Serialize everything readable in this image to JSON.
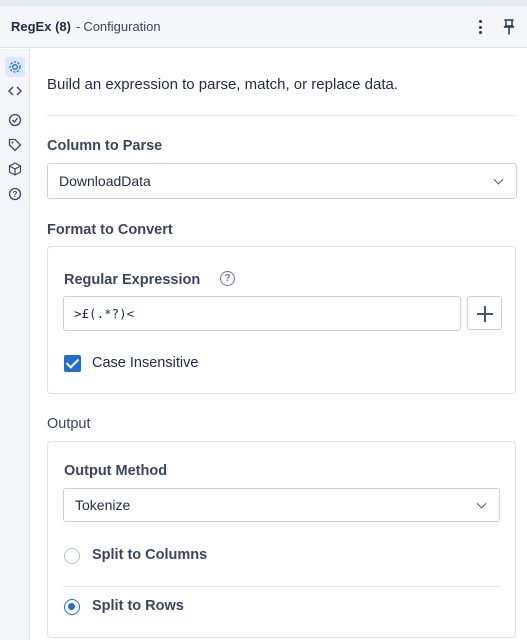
{
  "header": {
    "title_main": "RegEx (8)",
    "title_sep": "-",
    "title_sub": "Configuration"
  },
  "rail": {
    "icons": [
      "gear-icon",
      "code-icon",
      "tool-icon",
      "tag-icon",
      "cube-icon",
      "help-icon"
    ]
  },
  "description": "Build an expression to parse, match, or replace data.",
  "column_to_parse": {
    "label": "Column to Parse",
    "value": "DownloadData"
  },
  "format_to_convert": {
    "label": "Format to Convert",
    "regex_label": "Regular Expression",
    "help_glyph": "?",
    "regex_value": ">£(.*?)<",
    "case_insensitive_label": "Case Insensitive",
    "case_insensitive_checked": true
  },
  "output": {
    "label": "Output",
    "method_label": "Output Method",
    "method_value": "Tokenize",
    "options": [
      {
        "label": "Split to Columns",
        "selected": false
      },
      {
        "label": "Split to Rows",
        "selected": true
      }
    ]
  },
  "colors": {
    "accent": "#1f6ed4",
    "text": "#1f2a44",
    "header_bg": "#f5f6f9"
  }
}
